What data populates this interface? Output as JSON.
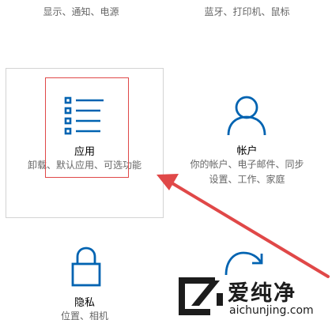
{
  "settings_tiles": {
    "system": {
      "desc": "显示、通知、电源"
    },
    "devices": {
      "desc": "蓝牙、打印机、鼠标"
    },
    "apps": {
      "title": "应用",
      "desc": "卸载、默认应用、可选功能",
      "icon": "apps-list-icon"
    },
    "accounts": {
      "title": "帐户",
      "desc_line1": "你的帐户、电子邮件、同步",
      "desc_line2": "设置、工作、家庭",
      "icon": "person-icon"
    },
    "privacy": {
      "title": "隐私",
      "desc": "位置、相机",
      "icon": "lock-icon"
    },
    "update": {
      "icon": "refresh-icon"
    }
  },
  "annotation": {
    "highlight_color": "#e04848",
    "arrow_color": "#e04848"
  },
  "watermark": {
    "text": "爱纯净",
    "url": "aichunjing.com"
  },
  "colors": {
    "accent": "#0063b1"
  }
}
